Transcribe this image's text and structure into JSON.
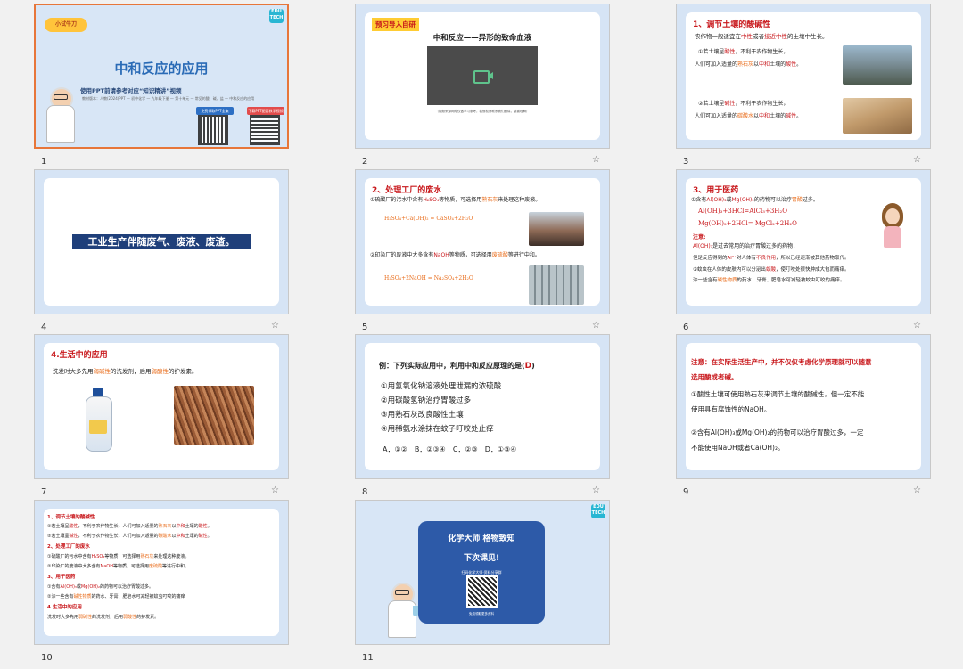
{
  "slides": [
    {
      "number": "1",
      "badge": "小试牛刀",
      "title": "中和反应的应用",
      "subtitle": "使用PPT前请参考对应“知识精讲”视频",
      "meta": "教材版本：人教(2024)PPT — 初中化学 — 九年级下册 — 第十单元 — 常见的酸、碱、盐 — 中和反应的应用",
      "btn1": "免费领取PPT全集",
      "btn2": "下载PPT配套教学视频",
      "logo": "EDU TECH"
    },
    {
      "number": "2",
      "tag": "预习导入自研",
      "title": "中和反应——异形的致命血液",
      "caption": "（视频来源网络仅做学习参考，若侵权请联系我们删除，感谢理解）"
    },
    {
      "number": "3",
      "heading": "1、调节土壤的酸碱性",
      "intro_a": "农作物一般适宜在",
      "intro_b": "中性",
      "intro_c": "或者",
      "intro_d": "接近中性",
      "intro_e": "的土壤中生长。",
      "p1a": "①若土壤呈",
      "p1b": "酸性",
      "p1c": "，不利于农作物生长，",
      "p2a": "人们可加入适量的",
      "p2b": "熟石灰",
      "p2c": "以",
      "p2d": "中和",
      "p2e": "土壤的",
      "p2f": "酸性",
      "p2g": "。",
      "p3a": "②若土壤呈",
      "p3b": "碱性",
      "p3c": "，不利于农作物生长，",
      "p4a": "人们可加入适量的",
      "p4b": "碳酸水",
      "p4c": "以",
      "p4d": "中和",
      "p4e": "土壤的",
      "p4f": "碱性",
      "p4g": "。"
    },
    {
      "number": "4",
      "banner": "工业生产伴随废气、废液、废渣。"
    },
    {
      "number": "5",
      "heading": "2、处理工厂的废水",
      "l1a": "①硫酸厂的污水中含有",
      "l1b": "H₂SO₄",
      "l1c": "等物质，可选择用",
      "l1d": "熟石灰",
      "l1e": "来处理这种废液。",
      "eq1": "H₂SO₄+Ca(OH)₂ = CaSO₄+2H₂O",
      "l2a": "②印染厂的废液中大多含有",
      "l2b": "NaOH",
      "l2c": "等物质，可选择用",
      "l2d": "废硫酸",
      "l2e": "等进行中和。",
      "eq2": "H₂SO₄+2NaOH = Na₂SO₄+2H₂O"
    },
    {
      "number": "6",
      "heading": "3、用于医药",
      "l1a": "①含有",
      "l1b": "Al(OH)₃",
      "l1c": "或",
      "l1d": "Mg(OH)₂",
      "l1e": "的药物可以治疗",
      "l1f": "胃酸",
      "l1g": "过多。",
      "eq1": "Al(OH)₃+3HCl=AlCl₃+3H₂O",
      "eq2": "Mg(OH)₂+2HCl= MgCl₂+2H₂O",
      "note": "注意:",
      "n1a": "Al(OH)₃",
      "n1b": "是过去常用的治疗胃酸过多的药物，",
      "n2a": "但是反应得到的",
      "n2b": "Al³⁺",
      "n2c": "对人体有",
      "n2d": "不良作用",
      "n2e": "，所以已经逐渐被其他药物取代。",
      "n3a": "②蚊虫在人体的皮肤内可以分泌出",
      "n3b": "蚁酸",
      "n3c": "，使叮咬处很快肿成大包而痛痒。",
      "n4a": "涂一些含有",
      "n4b": "碱性物质",
      "n4c": "的药水、牙膏、肥皂水可减轻被蚊虫叮咬的痛痒。"
    },
    {
      "number": "7",
      "heading": "4.生活中的应用",
      "la": "洗发时大多先用",
      "lb": "弱碱性",
      "lc": "的洗发剂，后用",
      "ld": "弱酸性",
      "le": "的护发素。"
    },
    {
      "number": "8",
      "qa": "例：下列实际应用中，利用中和反应原理的是(",
      "qb": "D",
      "qc": ")",
      "o1": "①用氢氧化钠溶液处理泄漏的浓硫酸",
      "o2": "②用碳酸氢钠治疗胃酸过多",
      "o3": "③用熟石灰改良酸性土壤",
      "o4": "④用稀氨水涂抹在蚊子叮咬处止痒",
      "choices": "A．①②　B．②③④　C．②③　D．①③④"
    },
    {
      "number": "9",
      "n1": "注意：在实际生活生产中，并不仅仅考虑化学原理就可以随意",
      "n2": "选用酸或者碱。",
      "p1": "①酸性土壤可使用熟石灰来调节土壤的酸碱性，但一定不能",
      "p2": "使用具有腐蚀性的NaOH。",
      "p3": "②含有Al(OH)₃或Mg(OH)₂的药物可以治疗胃酸过多，一定",
      "p4": "不能使用NaOH或者Ca(OH)₂。"
    },
    {
      "number": "10",
      "h1": "1、调节土壤的酸碱性",
      "a1a": "①若土壤呈",
      "a1b": "酸性",
      "a1c": "，不利于农作物生长，人们可加入适量的",
      "a1d": "熟石灰",
      "a1e": "以",
      "a1f": "中和",
      "a1g": "土壤的",
      "a1h": "酸性",
      "a1i": "。",
      "a2a": "②若土壤呈",
      "a2b": "碱性",
      "a2c": "，不利于农作物生长，人们可加入适量的",
      "a2d": "碳酸水",
      "a2e": "以",
      "a2f": "中和",
      "a2g": "土壤的",
      "a2h": "碱性",
      "a2i": "。",
      "h2": "2、处理工厂的废水",
      "b1a": "①硫酸厂的污水中含有",
      "b1b": "H₂SO₄",
      "b1c": "等物质，可选择用",
      "b1d": "熟石灰",
      "b1e": "来处理这种废液。",
      "b2a": "②印染厂的废液中大多含有",
      "b2b": "NaOH",
      "b2c": "等物质，可选择用",
      "b2d": "废硫酸",
      "b2e": "等进行中和。",
      "h3": "3、用于医药",
      "c1a": "①含有",
      "c1b": "Al(OH)₃",
      "c1c": "或",
      "c1d": "Mg(OH)₂",
      "c1e": "的药物可以治疗胃酸过多。",
      "c2a": "②涂一些含有",
      "c2b": "碱性物质",
      "c2c": "的药水、牙膏、肥皂水可减轻被蚊虫叮咬的痛痒",
      "h4": "4.生活中的应用",
      "d1a": "洗发时大多先用",
      "d1b": "弱碱性",
      "d1c": "的洗发剂，后用",
      "d1d": "弱酸性",
      "d1e": "的护发素。"
    },
    {
      "number": "11",
      "line1": "化学大师  格物致知",
      "line2": "下次课见!",
      "line3": "扫码化学大师·资料分享群",
      "line4": "免费领取更多资料",
      "logo": "EDU TECH"
    }
  ]
}
